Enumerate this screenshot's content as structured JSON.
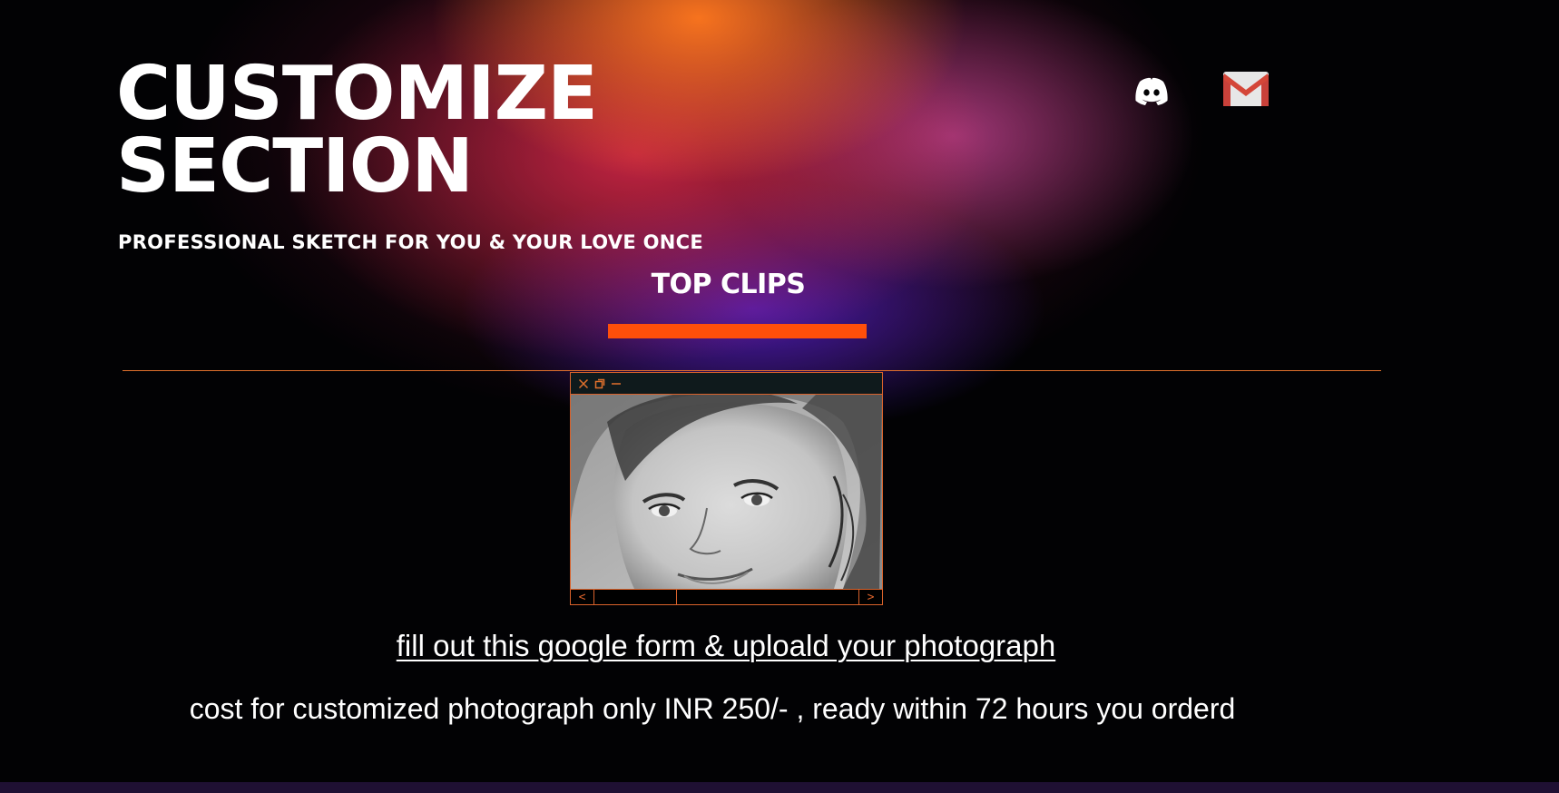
{
  "hero": {
    "title_line1": "CUSTOMIZE",
    "title_line2": "SECTION",
    "subtitle": "PROFESSIONAL SKETCH FOR YOU & YOUR LOVE ONCE"
  },
  "social": [
    {
      "icon": "discord-icon"
    },
    {
      "icon": "gmail-icon"
    }
  ],
  "clips": {
    "heading": "TOP CLIPS",
    "viewer": {
      "controls": [
        "close-icon",
        "restore-icon",
        "minimize-icon"
      ],
      "prev_label": "<",
      "next_label": ">",
      "image": "pencil-sketch-portrait"
    }
  },
  "cta": {
    "form_link": "fill out this google form &  uploald your photograph",
    "cost_text": "cost for customized photograph only INR 250/- , ready within 72 hours you orderd"
  },
  "colors": {
    "accent": "#ff4f0a",
    "divider": "#e0702c",
    "background": "#020204",
    "footer": "#1f1033"
  }
}
